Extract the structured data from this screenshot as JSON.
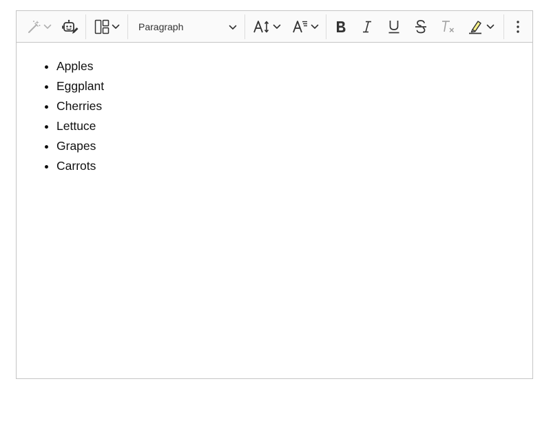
{
  "toolbar": {
    "items": [
      {
        "name": "ai-assistant",
        "icon": "magic-wand-icon"
      },
      {
        "name": "ai-commands",
        "icon": "robot-pencil-icon"
      },
      {
        "name": "layouts",
        "icon": "layout-icon"
      },
      {
        "name": "heading",
        "icon": "chevron-down-icon"
      },
      {
        "name": "font-size",
        "icon": "font-size-icon"
      },
      {
        "name": "line-height",
        "icon": "line-height-icon"
      },
      {
        "name": "bold",
        "icon": "bold-icon"
      },
      {
        "name": "italic",
        "icon": "italic-icon"
      },
      {
        "name": "underline",
        "icon": "underline-icon"
      },
      {
        "name": "strikethrough",
        "icon": "strikethrough-icon"
      },
      {
        "name": "remove-format",
        "icon": "remove-format-icon"
      },
      {
        "name": "highlight",
        "icon": "highlighter-icon"
      },
      {
        "name": "more",
        "icon": "more-vertical-icon"
      }
    ],
    "heading_label": "Paragraph",
    "highlight_color": "#fcf48c"
  },
  "content": {
    "list": [
      "Apples",
      "Eggplant",
      "Cherries",
      "Lettuce",
      "Grapes",
      "Carrots"
    ]
  }
}
